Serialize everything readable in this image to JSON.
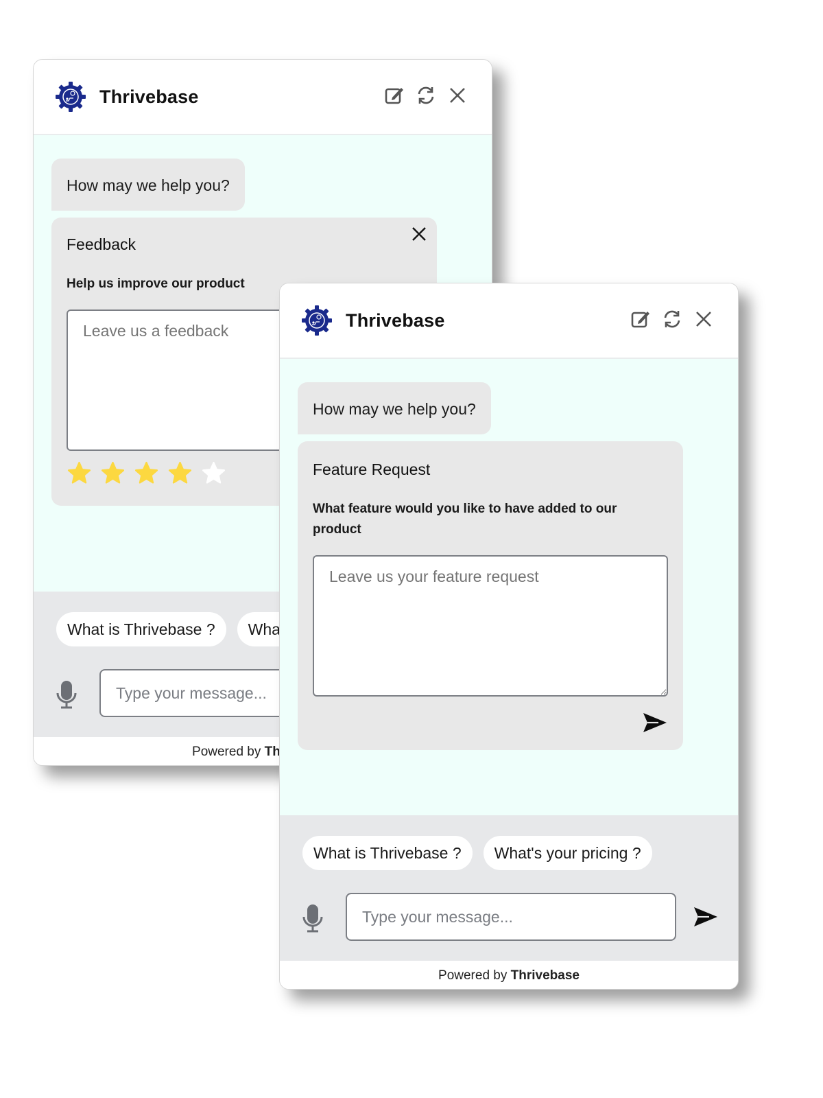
{
  "back_window": {
    "brand": "Thrivebase",
    "header_icons": [
      "new-chat-icon",
      "refresh-icon",
      "close-icon"
    ],
    "greeting": "How may we help you?",
    "card": {
      "title": "Feedback",
      "subtitle": "Help us improve our product",
      "textarea_placeholder": "Leave us a feedback",
      "rating": {
        "value": 4,
        "max": 5
      }
    },
    "quick_replies": [
      "What is Thrivebase ?",
      "What's your pricing ?"
    ],
    "message_placeholder": "Type your message...",
    "footer": {
      "prefix": "Powered by",
      "brand": "Thrivebase"
    }
  },
  "front_window": {
    "brand": "Thrivebase",
    "header_icons": [
      "new-chat-icon",
      "refresh-icon",
      "close-icon"
    ],
    "greeting": "How may we help you?",
    "card": {
      "title": "Feature Request",
      "subtitle": "What feature would you like to have added to our product",
      "textarea_placeholder": "Leave us your feature request"
    },
    "quick_replies": [
      "What is Thrivebase ?",
      "What's your pricing ?"
    ],
    "message_placeholder": "Type your message...",
    "footer": {
      "prefix": "Powered by",
      "brand": "Thrivebase"
    }
  },
  "colors": {
    "brand_logo": "#1a2a8c",
    "chat_background": "#effffb",
    "bubble": "#e8e8e8",
    "input_area": "#e7e8ea",
    "star_filled": "#fcd840",
    "star_empty": "#ffffff"
  }
}
